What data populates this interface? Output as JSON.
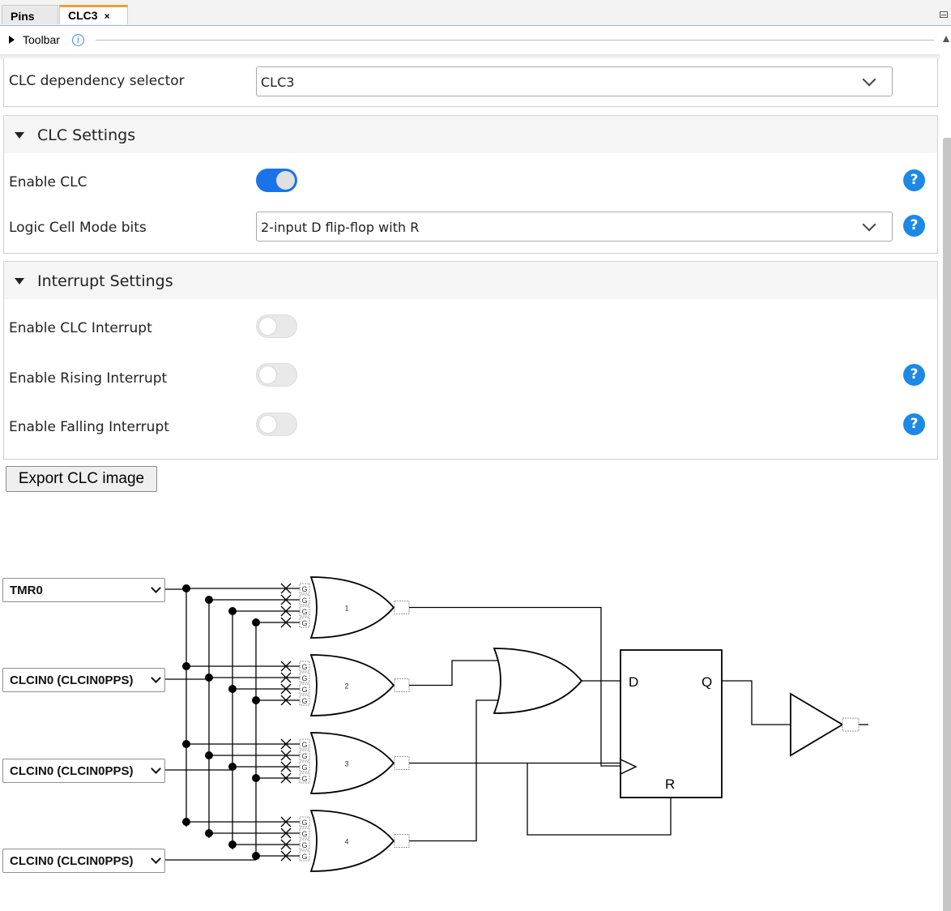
{
  "tabs": [
    {
      "label": "Pins"
    },
    {
      "label": "CLC3",
      "close": "×"
    }
  ],
  "toolbar": {
    "label": "Toolbar",
    "info": "i"
  },
  "dependency": {
    "label": "CLC dependency selector",
    "value": "CLC3"
  },
  "clc_settings": {
    "title": "CLC Settings",
    "enable_clc": {
      "label": "Enable CLC",
      "on": true
    },
    "mode": {
      "label": "Logic Cell Mode bits",
      "value": "2-input D flip-flop with R"
    }
  },
  "interrupt_settings": {
    "title": "Interrupt Settings",
    "enable_interrupt": {
      "label": "Enable CLC Interrupt",
      "on": false
    },
    "rising": {
      "label": "Enable Rising Interrupt",
      "on": false
    },
    "falling": {
      "label": "Enable Falling Interrupt",
      "on": false
    }
  },
  "help_symbol": "?",
  "export_button": "Export CLC image",
  "diagram": {
    "inputs": [
      "TMR0",
      "CLCIN0 (CLCIN0PPS)",
      "CLCIN0 (CLCIN0PPS)",
      "CLCIN0 (CLCIN0PPS)"
    ],
    "gate_labels": [
      "1",
      "2",
      "3",
      "4"
    ],
    "ff": {
      "d": "D",
      "q": "Q",
      "r": "R"
    },
    "inverter_glyph": "G"
  },
  "colors": {
    "accent": "#1a73e8",
    "help": "#1e88e5",
    "tab_highlight": "#f0a030"
  }
}
